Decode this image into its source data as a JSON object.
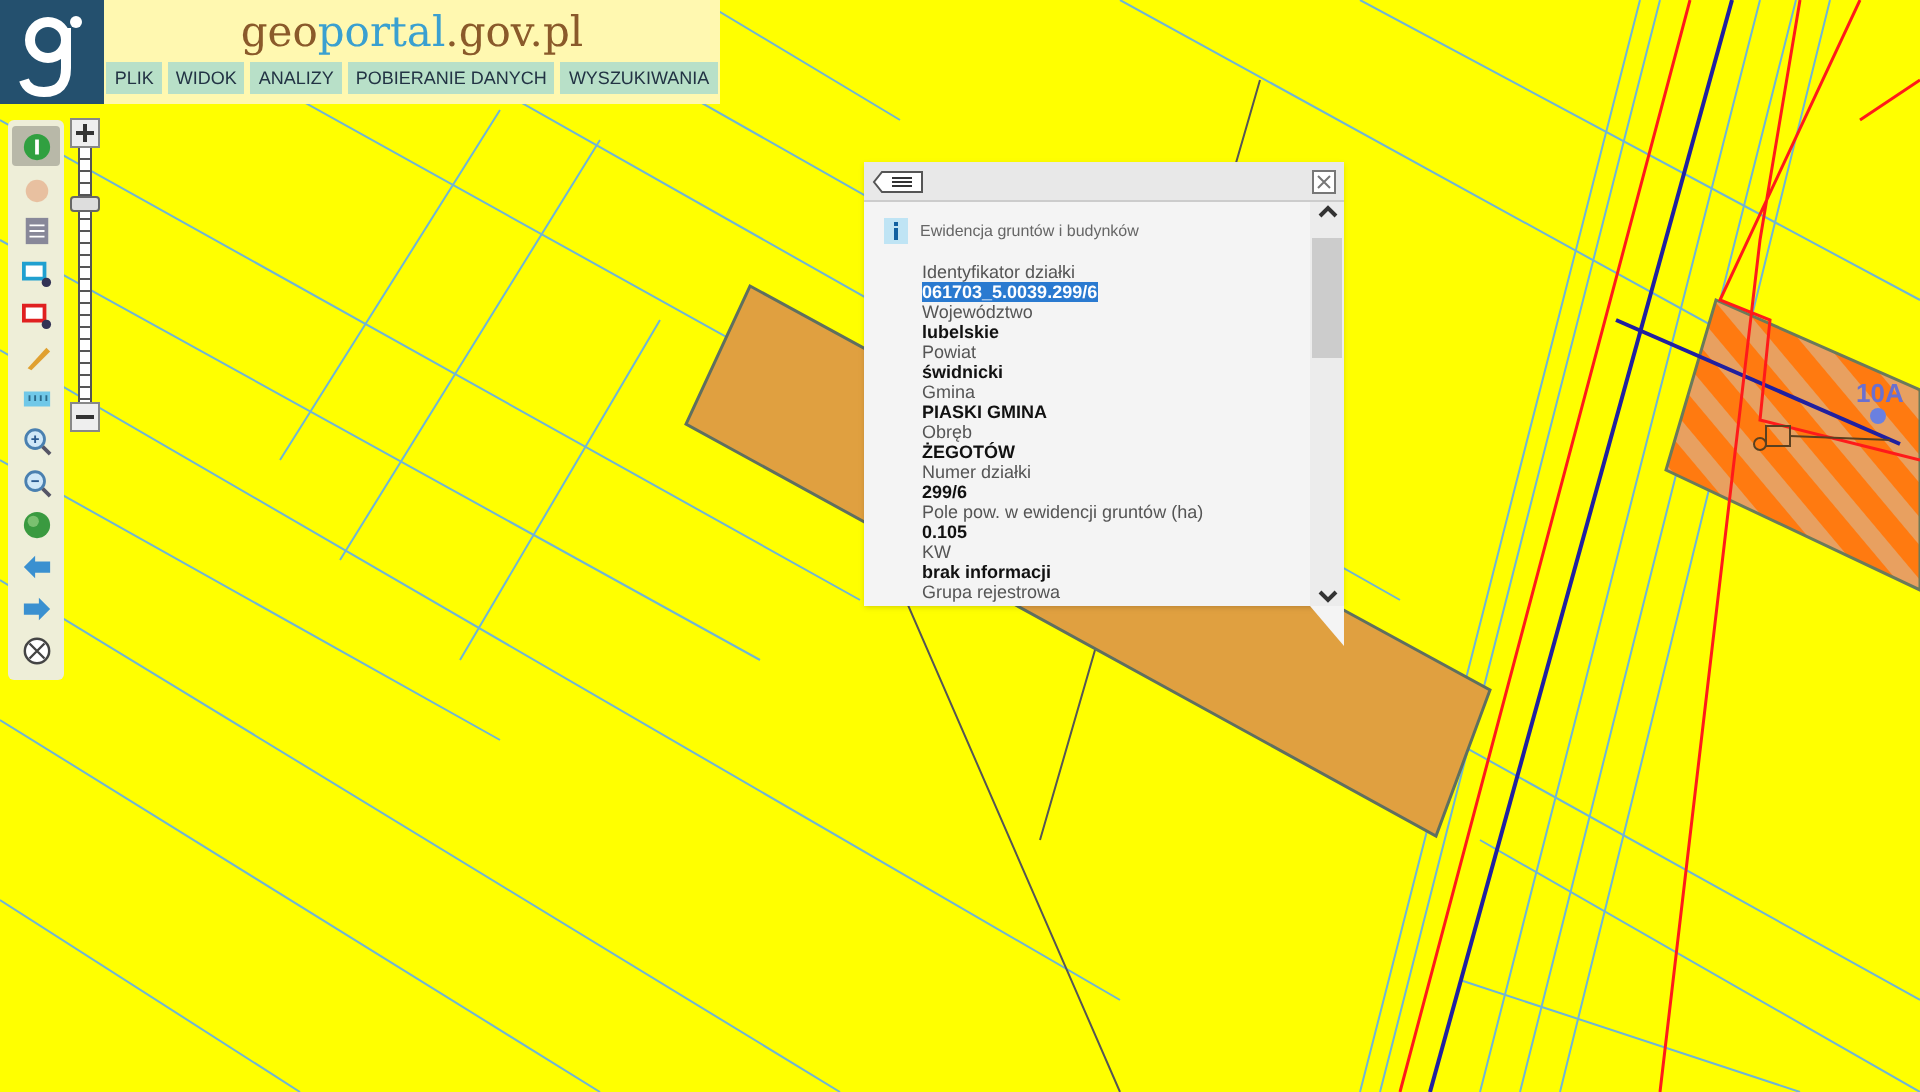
{
  "header": {
    "logo_parts": [
      "geo",
      "portal",
      ".gov.pl"
    ],
    "menu": [
      "PLIK",
      "WIDOK",
      "ANALIZY",
      "POBIERANIE DANYCH",
      "WYSZUKIWANIA"
    ]
  },
  "tools": [
    {
      "selected": true
    },
    {
      "selected": false
    },
    {
      "selected": false
    },
    {
      "selected": false
    },
    {
      "selected": false
    },
    {
      "selected": false
    },
    {
      "selected": false
    },
    {
      "selected": false
    },
    {
      "selected": false
    },
    {
      "selected": false
    },
    {
      "selected": false
    },
    {
      "selected": false
    },
    {
      "selected": false
    }
  ],
  "zoom": {
    "level": 0.8
  },
  "map": {
    "labels": [
      "10A"
    ]
  },
  "popup": {
    "title": "Ewidencja gruntów i budynków",
    "fields": [
      {
        "label": "Identyfikator działki",
        "value": "061703_5.0039.299/6",
        "selected": true
      },
      {
        "label": "Województwo",
        "value": "lubelskie",
        "selected": false
      },
      {
        "label": "Powiat",
        "value": "świdnicki",
        "selected": false
      },
      {
        "label": "Gmina",
        "value": "PIASKI GMINA",
        "selected": false
      },
      {
        "label": "Obręb",
        "value": "ŻEGOTÓW",
        "selected": false
      },
      {
        "label": "Numer działki",
        "value": "299/6",
        "selected": false
      },
      {
        "label": "Pole pow. w ewidencji gruntów (ha)",
        "value": "0.105",
        "selected": false
      },
      {
        "label": "KW",
        "value": "brak informacji",
        "selected": false
      },
      {
        "label": "Grupa rejestrowa"
      }
    ]
  }
}
